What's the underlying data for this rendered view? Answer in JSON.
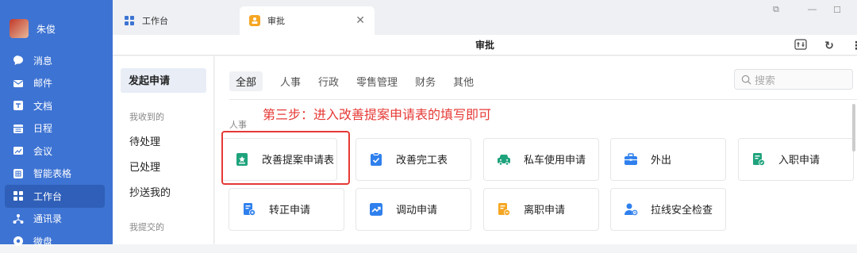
{
  "user": {
    "name": "朱俊"
  },
  "sidebar": {
    "items": [
      {
        "label": "消息",
        "icon": "chat-icon",
        "active": false
      },
      {
        "label": "邮件",
        "icon": "mail-icon",
        "active": false
      },
      {
        "label": "文档",
        "icon": "doc-icon",
        "active": false
      },
      {
        "label": "日程",
        "icon": "calendar-icon",
        "active": false
      },
      {
        "label": "会议",
        "icon": "meeting-icon",
        "active": false
      },
      {
        "label": "智能表格",
        "icon": "table-icon",
        "active": false
      },
      {
        "label": "工作台",
        "icon": "grid-icon",
        "active": true
      },
      {
        "label": "通讯录",
        "icon": "contacts-icon",
        "active": false
      },
      {
        "label": "微盘",
        "icon": "drive-icon",
        "active": false
      }
    ]
  },
  "tabs": [
    {
      "label": "工作台"
    },
    {
      "label": "审批"
    }
  ],
  "page": {
    "title": "审批"
  },
  "left_pane": {
    "active": "发起申请",
    "section_received": "我收到的",
    "items": [
      "待处理",
      "已处理",
      "抄送我的"
    ],
    "section_submitted": "我提交的"
  },
  "categories": [
    "全部",
    "人事",
    "行政",
    "零售管理",
    "财务",
    "其他"
  ],
  "search": {
    "placeholder": "搜索"
  },
  "annotation": "第三步：进入改善提案申请表的填写即可",
  "group_label": "人事",
  "cards": [
    {
      "label": "改善提案申请表",
      "icon": "proposal-icon",
      "color": "#1fa37c"
    },
    {
      "label": "改善完工表",
      "icon": "clipboard-check-icon",
      "color": "#2f80ed"
    },
    {
      "label": "私车使用申请",
      "icon": "car-icon",
      "color": "#1fa37c"
    },
    {
      "label": "外出",
      "icon": "briefcase-icon",
      "color": "#2f80ed"
    },
    {
      "label": "入职申请",
      "icon": "onboard-icon",
      "color": "#1fa37c"
    },
    {
      "label": "转正申请",
      "icon": "regularize-icon",
      "color": "#2f80ed"
    },
    {
      "label": "调动申请",
      "icon": "transfer-icon",
      "color": "#2f80ed"
    },
    {
      "label": "离职申请",
      "icon": "resign-icon",
      "color": "#f5a623"
    },
    {
      "label": "拉线安全检查",
      "icon": "safety-check-icon",
      "color": "#2f80ed"
    }
  ],
  "colors": {
    "sidebar": "#3d73d3",
    "highlight": "#e53935",
    "accent": "#2f80ed"
  }
}
